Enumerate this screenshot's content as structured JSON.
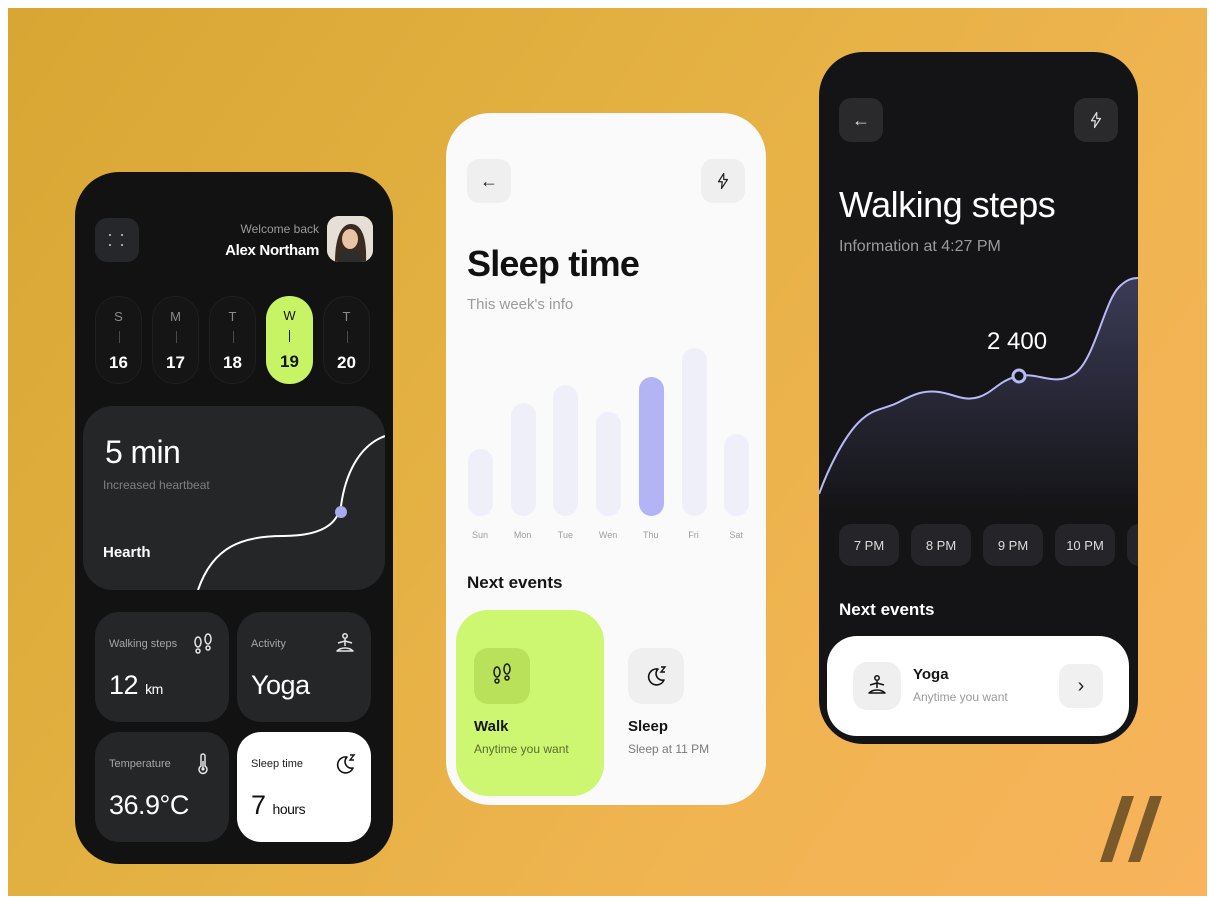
{
  "dashboard": {
    "welcome": "Welcome back",
    "user_name": "Alex Northam",
    "days": [
      {
        "letter": "S",
        "num": "16"
      },
      {
        "letter": "M",
        "num": "17"
      },
      {
        "letter": "T",
        "num": "18"
      },
      {
        "letter": "W",
        "num": "19"
      },
      {
        "letter": "T",
        "num": "20"
      }
    ],
    "selected_day": "19",
    "heart": {
      "value": "5 min",
      "subtitle": "Increased heartbeat",
      "label": "Hearth"
    },
    "tiles": {
      "walking": {
        "label": "Walking steps",
        "value": "12",
        "unit": "km",
        "icon": "footsteps-icon"
      },
      "activity": {
        "label": "Activity",
        "value": "Yoga",
        "icon": "meditation-icon"
      },
      "temperature": {
        "label": "Temperature",
        "value": "36.9°C",
        "icon": "thermometer-icon"
      },
      "sleep": {
        "label": "Sleep time",
        "value": "7",
        "unit": "hours",
        "icon": "moon-sleep-icon"
      }
    }
  },
  "sleep_screen": {
    "title": "Sleep time",
    "subtitle": "This week's info",
    "chart_data": {
      "type": "bar",
      "categories": [
        "Sun",
        "Mon",
        "Tue",
        "Wen",
        "Thu",
        "Fri",
        "Sat"
      ],
      "values": [
        0.4,
        0.67,
        0.78,
        0.62,
        0.83,
        1.0,
        0.49
      ],
      "highlight": "Thu",
      "colors": {
        "bar": "#eeeff9",
        "highlight": "#b3b4f5"
      }
    },
    "next_events": "Next events",
    "events": [
      {
        "title": "Walk",
        "subtitle": "Anytime you want",
        "icon": "footsteps-icon"
      },
      {
        "title": "Sleep",
        "subtitle": "Sleep at 11 PM",
        "icon": "moon-sleep-icon"
      }
    ]
  },
  "steps_screen": {
    "title": "Walking steps",
    "subtitle": "Information at 4:27 PM",
    "peak_value": "2 400",
    "times": [
      "7 PM",
      "8 PM",
      "9 PM",
      "10 PM"
    ],
    "next_events": "Next events",
    "event": {
      "title": "Yoga",
      "subtitle": "Anytime you want",
      "icon": "meditation-icon"
    }
  },
  "colors": {
    "accent_green": "#c7f464",
    "accent_lavender": "#b3b4f5",
    "background_gradient": "#e2b040"
  }
}
